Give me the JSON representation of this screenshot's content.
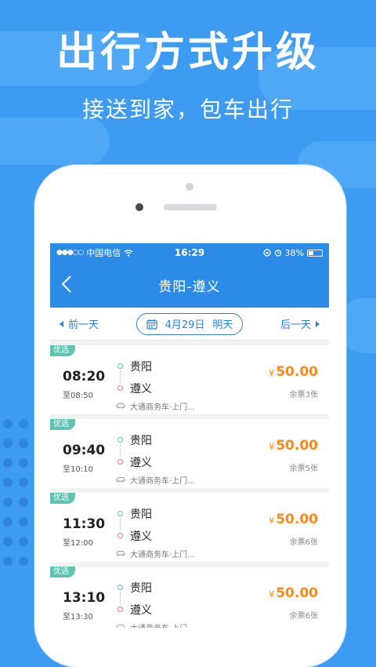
{
  "headline": "出行方式升级",
  "subline": "接送到家，包车出行",
  "status": {
    "carrier": "中国电信",
    "time": "16:29",
    "battery": "38%"
  },
  "nav": {
    "title": "贵阳-遵义"
  },
  "datebar": {
    "prev": "前一天",
    "date": "4月29日",
    "day": "明天",
    "next": "后一天"
  },
  "trips": [
    {
      "tag": "优选",
      "time": "08:20",
      "arrive": "至08:50",
      "origin": "贵阳",
      "dest": "遵义",
      "service": "大通商务车·上门...",
      "price": "50.00",
      "remain": "余票3张"
    },
    {
      "tag": "优选",
      "time": "09:40",
      "arrive": "至10:10",
      "origin": "贵阳",
      "dest": "遵义",
      "service": "大通商务车·上门...",
      "price": "50.00",
      "remain": "余票5张"
    },
    {
      "tag": "优选",
      "time": "11:30",
      "arrive": "至12:00",
      "origin": "贵阳",
      "dest": "遵义",
      "service": "大通商务车·上门...",
      "price": "50.00",
      "remain": "余票6张"
    },
    {
      "tag": "优选",
      "time": "13:10",
      "arrive": "至13:30",
      "origin": "贵阳",
      "dest": "遵义",
      "service": "大通商务车·上门...",
      "price": "50.00",
      "remain": "余票6张"
    }
  ],
  "currency": "¥",
  "colors": {
    "background": "#3d9bf2",
    "primary": "#2b8be6",
    "price": "#ff8a1c",
    "tag": "#5ec3b1"
  }
}
